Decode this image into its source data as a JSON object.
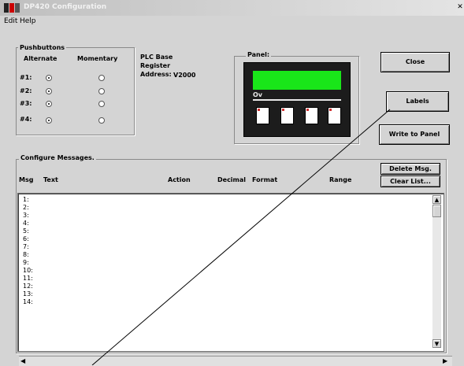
{
  "window": {
    "title": "DP420 Configuration"
  },
  "menu": [
    {
      "label": "Edit"
    },
    {
      "label": "Help"
    }
  ],
  "pushbuttons": {
    "group_label": "Pushbuttons",
    "col_alternate": "Alternate",
    "col_momentary": "Momentary",
    "rows": [
      {
        "label": "#1:",
        "selected": "alternate"
      },
      {
        "label": "#2:",
        "selected": "alternate"
      },
      {
        "label": "#3:",
        "selected": "alternate"
      },
      {
        "label": "#4:",
        "selected": "alternate"
      }
    ]
  },
  "plc": {
    "line1": "PLC Base",
    "line2": "Register",
    "address_label": "Address:",
    "address_value": "V2000"
  },
  "panel": {
    "label": "Panel:",
    "lcd_color": "#19e619",
    "bar_text": "Ov",
    "keys": 4
  },
  "buttons": {
    "close": "Close",
    "labels": "Labels",
    "write": "Write to Panel",
    "delete": "Delete Msg.",
    "clear": "Clear List..."
  },
  "messages": {
    "group_label": "Configure Messages.",
    "columns": {
      "msg": "Msg",
      "text": "Text",
      "action": "Action",
      "decimal": "Decimal",
      "format": "Format",
      "range": "Range"
    },
    "rows": [
      "1:",
      "2:",
      "3:",
      "4:",
      "5:",
      "6:",
      "7:",
      "8:",
      "9:",
      "10:",
      "11:",
      "12:",
      "13:",
      "14:"
    ]
  }
}
